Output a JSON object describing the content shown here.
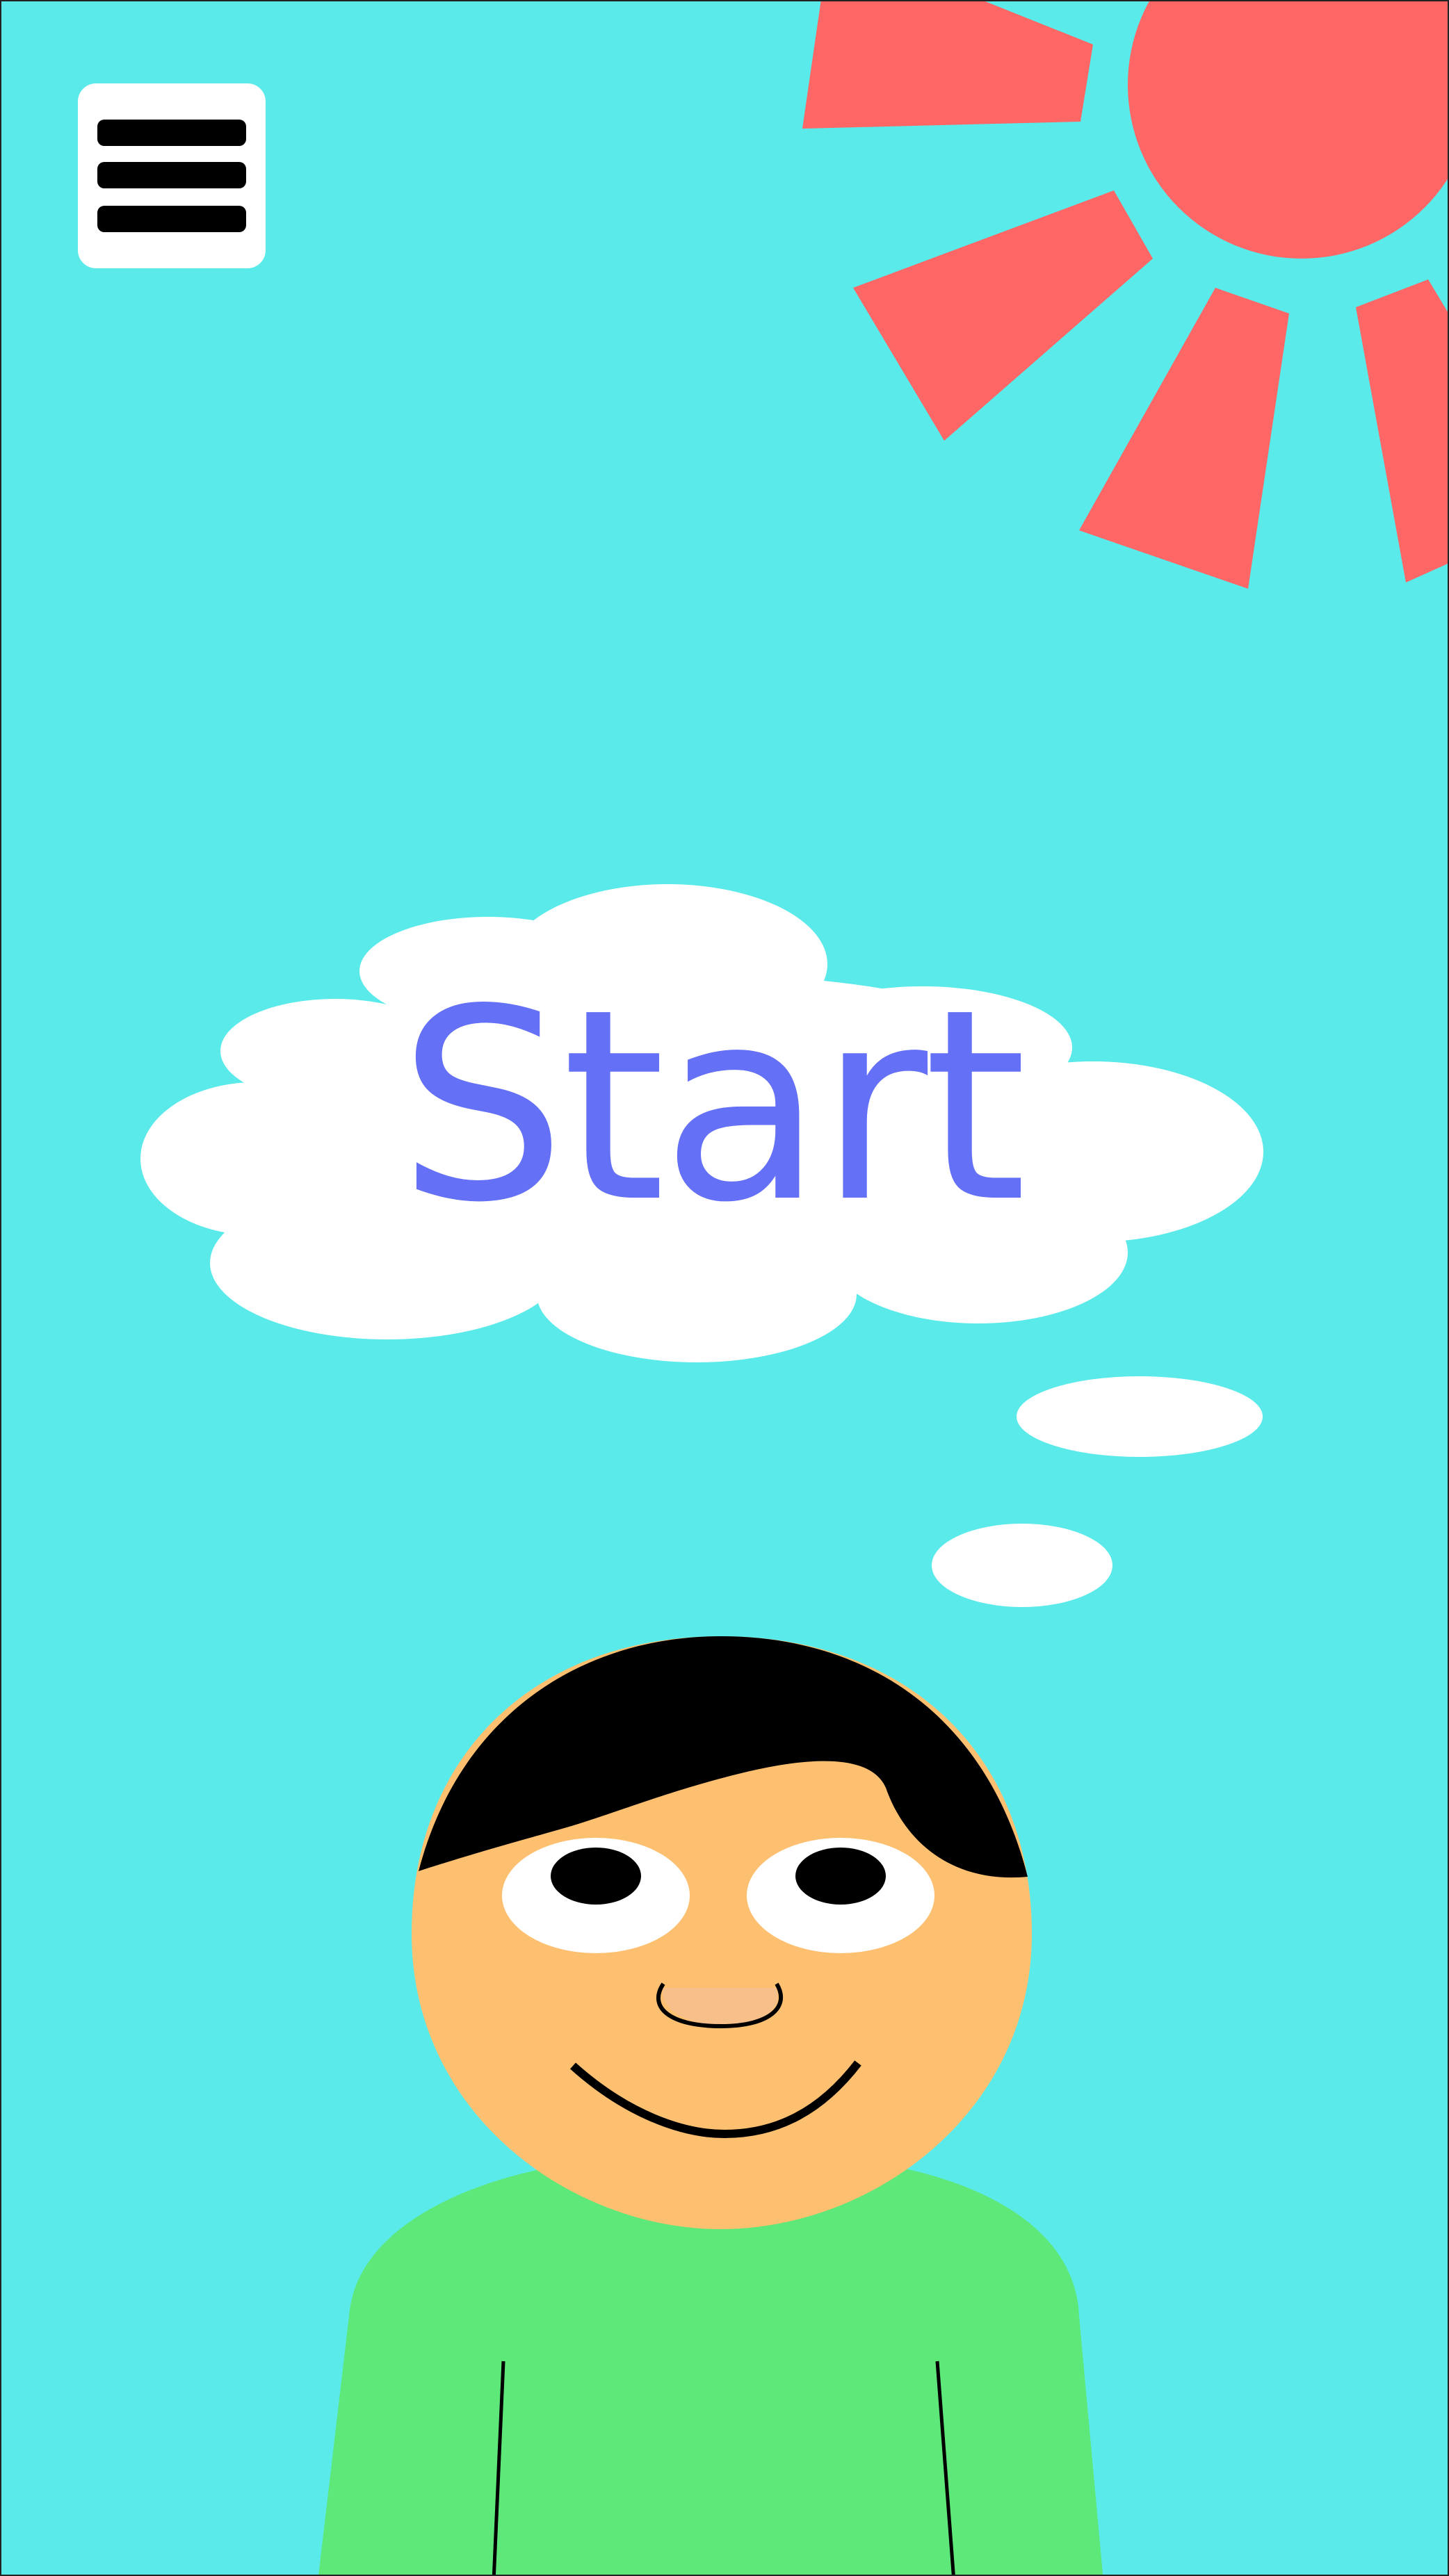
{
  "screen": {
    "name": "start-screen"
  },
  "menu": {
    "icon": "hamburger-menu-icon"
  },
  "start_button": {
    "label": "Start"
  },
  "colors": {
    "sky": "#5BEAEA",
    "sun": "#FF6666",
    "cloud": "#FFFFFF",
    "start_text": "#6470F5",
    "skin": "#FDC070",
    "hair": "#000000",
    "shirt": "#5EE87A",
    "nose": "#F7C08A"
  }
}
